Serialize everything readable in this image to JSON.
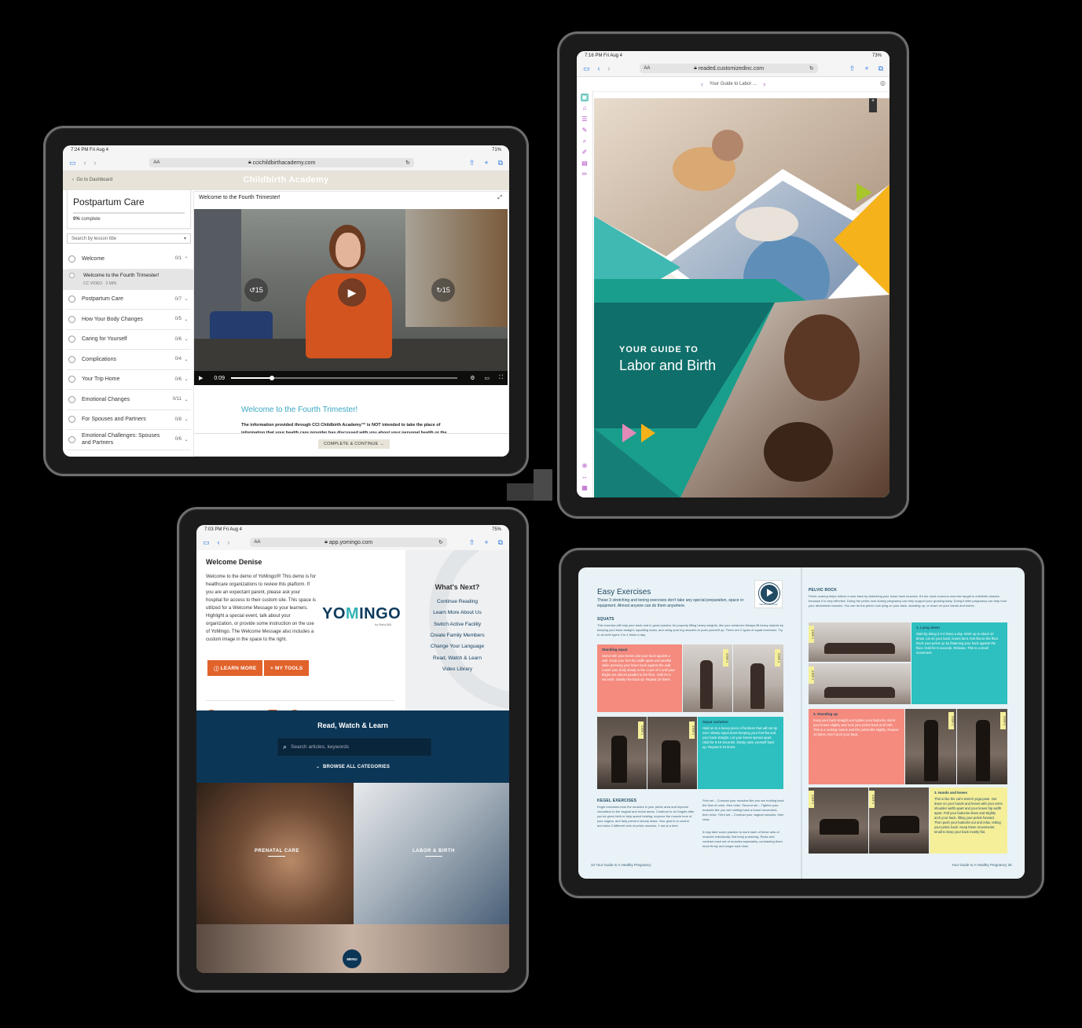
{
  "device1": {
    "status": {
      "time": "7:24 PM  Fri Aug 4",
      "battery": "71%"
    },
    "url": "ccichildbirthacademy.com",
    "aa": "AA",
    "banner": {
      "back": "Go to Dashboard",
      "logo": "Childbirth Academy"
    },
    "course": {
      "title": "Postpartum Care",
      "progress_pct": "0%",
      "progress_label": "complete"
    },
    "search_placeholder": "Search by lesson title",
    "lessons": [
      {
        "name": "Welcome",
        "count": "0/1",
        "open": true
      },
      {
        "name": "Postpartum Care",
        "count": "0/7"
      },
      {
        "name": "How Your Body Changes",
        "count": "0/5"
      },
      {
        "name": "Caring for Yourself",
        "count": "0/6"
      },
      {
        "name": "Complications",
        "count": "0/4"
      },
      {
        "name": "Your Trip Home",
        "count": "0/6"
      },
      {
        "name": "Emotional Changes",
        "count": "0/11"
      },
      {
        "name": "For Spouses and Partners",
        "count": "0/8"
      },
      {
        "name": "Emotional Challenges: Spouses and Partners",
        "count": "0/6"
      }
    ],
    "sub_lesson": {
      "title": "Welcome to the Fourth Trimester!",
      "meta": "CC  VIDEO · 2 MIN"
    },
    "video": {
      "title": "Welcome to the Fourth Trimester!",
      "time": "0:09",
      "skip_back": "15",
      "skip_fwd": "15",
      "progress": 0.18
    },
    "lesson_heading": "Welcome to the Fourth Trimester!",
    "lesson_body": "The information provided through CCI Childbirth Academy™ is NOT intended to take the place of information that your health care provider has discussed with you about your personal health or the",
    "complete_button": "COMPLETE & CONTINUE →"
  },
  "device2": {
    "status": {
      "time": "7:16 PM  Fri Aug 4",
      "battery": "73%"
    },
    "url": "readed.customizedinc.com",
    "aa": "AA",
    "breadcrumb": "Your Guide to Labor ...",
    "cover": {
      "kicker": "YOUR GUIDE TO",
      "title": "Labor and Birth"
    },
    "colors": {
      "teal": "#1a9e8c",
      "dark_teal": "#0f6f6a",
      "yellow": "#f6b21a",
      "lime": "#a8c52b",
      "pink": "#e28ab8"
    }
  },
  "device3": {
    "status": {
      "time": "7:03 PM  Fri Aug 4",
      "battery": "75%"
    },
    "url": "app.yomingo.com",
    "aa": "AA",
    "welcome": {
      "title": "Welcome Denise",
      "copy": "Welcome to the demo of YoMingo®! This demo is for healthcare organizations to review this platform. If you are an expectant parent, please ask your hospital for access to their custom site. This space is utilized for a Welcome Message to your learners. Highlight a special event, talk about your organization, or provide some instruction on the use of YoMingo. The Welcome Message also includes a custom image in the space to the right."
    },
    "logo": {
      "main": "YOMINGO",
      "sub": "by Baby365"
    },
    "buttons": {
      "learn_more": "LEARN MORE",
      "my_tools": "MY TOOLS"
    },
    "social": [
      "pinterest-icon",
      "twitter-icon",
      "globe-icon",
      "youtube-icon",
      "facebook-icon"
    ],
    "whats_next": {
      "title": "What's Next?",
      "links": [
        "Continue Reading",
        "Learn More About Us",
        "Switch Active Facility",
        "Create Family Members",
        "Change Your Language",
        "Read, Watch & Learn",
        "Video Library"
      ]
    },
    "rwl": {
      "title": "Read, Watch & Learn",
      "search_placeholder": "Search articles, keywords",
      "browse": "BROWSE ALL CATEGORIES"
    },
    "photos": {
      "prenatal": "PRENATAL CARE",
      "labor": "LABOR & BIRTH"
    },
    "menu": "MENU"
  },
  "device4": {
    "left": {
      "title": "Easy Exercises",
      "subtitle": "These 3 stretching and toning exercises don't take any special preparation, space or equipment. Almost anyone can do them anywhere.",
      "play_label": "TOUCH TO PLAY",
      "squats_heading": "SQUATS",
      "squats_intro": "This exercise will help your back and in good practice for properly lifting heavy weights, like your newborn! Always lift heavy objects by keeping your back straight, squatting down, and using your leg muscles to push yourself up. There are 2 types of squat exercises. Try to do both types 3 to 4 times a day.",
      "standing_squat_title": "Standing squat",
      "standing_squat": "Stand with your knees and your back against a wall. Keep your feet hip width apart and parallel while pressing your lower back against the wall. Lower your body slowly to the count of 5 until your thighs are almost parallel to the floor. Hold for 5 seconds. Slowly rise back up. Repeat 10 times.",
      "squat_variation_title": "Squat variation",
      "squat_variation": "Hold on to a heavy piece of furniture that will not tip over. Slowly squat down keeping your feet flat and your back straight. Let your knees spread apart. Hold for 5-10 seconds. Slowly raise yourself back up. Repeat 5-10 times.",
      "kegel_heading": "KEGEL EXERCISES",
      "kegel_text": "Kegel exercises tone the muscles in your pelvic area and improve circulation to the vaginal and rectal areas. Continue to do Kegels after you've given birth to help speed healing, improve the muscle tone of your vagina, and help prevent urinary leaks. Your goal is to control and relax 3 different sets of pelvic muscles, 1 set at a time.",
      "sets_text": "First set – Contract your muscles like you are holding back the flow of urine, then relax. Second set – Tighten your muscles like you are holding back a bowel movement, then relax. Third set – Contract your vaginal muscles, then relax.",
      "sets_more": "It may take some practice to work each of these sets of muscles individually. But keep practicing. Relax and contract each set of muscles separately, contracting them more firmly and longer each time.",
      "footer": "34  Your Guide to A Healthy Pregnancy"
    },
    "right": {
      "heading": "PELVIC ROCK",
      "intro": "Pelvic rocking helps relieve a sore back by stretching your lower back muscles. It's the most common exercise taught in childbirth classes because it is very effective. Doing the pelvic rock during pregnancy can help support your growing baby. Doing it after pregnancy can help tone your abdominal muscles. You can do the pelvic rock lying on your back, standing up, or down on your hands and knees.",
      "lying_down": "1. Lying down",
      "lying_text": "Start by doing it 3-4 times a day. Work up to about 10 times. Lie on your back, knees bent, feet flat on the floor. Rock your pelvis up by flattening your back against the floor. Hold for 5 seconds. Release. This is a small movement.",
      "standing_up": "2. Standing up",
      "standing_text": "Keep your back straight and tighten your buttocks. Bend your knees slightly and rock your pelvis back and forth. This is a rocking motion and the pelvis tilts slightly. Repeat 10 times. Don't arch your back.",
      "hands_knees": "3. Hands and knees",
      "hands_text": "This is like the cat's stretch yoga pose. Get down on your hands and knees with your arms shoulder width apart and your knees hip width apart. Pull your buttocks down and slightly arch your back, lifting your pelvis forward. Then push your buttocks out and relax, letting your pelvic back. Keep these movements small to keep your back mostly flat.",
      "footer": "Your Guide to A Healthy Pregnancy  35"
    },
    "colors": {
      "salmon": "#f48b7e",
      "teal": "#2ebfc0",
      "yellow": "#f5ef9a",
      "navy": "#214a63",
      "page": "#e9f2f6"
    }
  }
}
